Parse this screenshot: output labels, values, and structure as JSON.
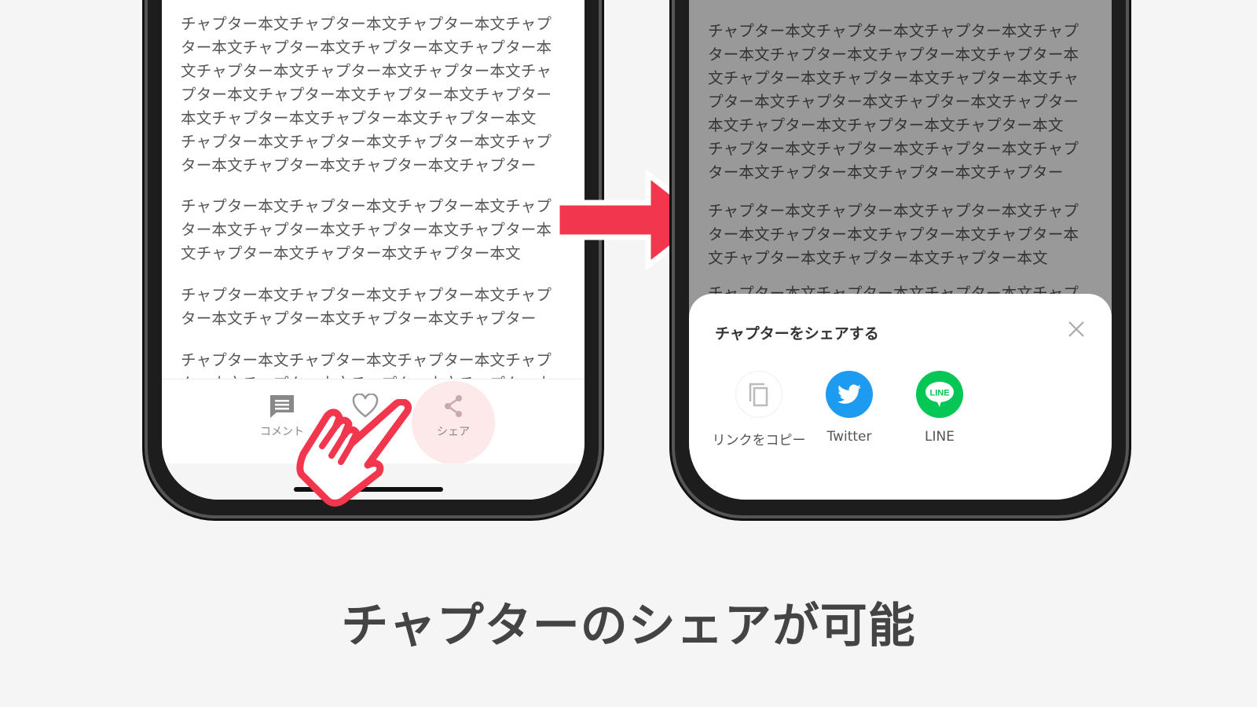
{
  "left_phone": {
    "paragraphs": [
      [
        "チャプター本文チャプター本文チャプター本文チャプ",
        "ター本文チャプター本文チャプター本文チャプター本",
        "文チャプター本文チャプター本文チャプター本文チャ",
        "プター本文チャプター本文チャプター本文チャプター",
        "本文チャプター本文チャプター本文チャプター本文",
        "チャプター本文チャプター本文チャプター本文チャプ",
        "ター本文チャプター本文チャプター本文チャプター"
      ],
      [
        "チャプター本文チャプター本文チャプター本文チャプ",
        "ター本文チャプター本文チャプター本文チャプター本",
        "文チャプター本文チャプター本文チャプター本文"
      ],
      [
        "チャプター本文チャプター本文チャプター本文チャプ",
        "ター本文チャプター本文チャプター本文チャプター"
      ],
      [
        "チャプター本文チャプター本文チャプター本文チャプ",
        "ター本文チャプター本文チャプター本文チャプター本"
      ]
    ],
    "tabs": {
      "comment": "コメント",
      "like": "",
      "share": "シェア"
    }
  },
  "right_phone": {
    "paragraphs": [
      [
        "チャプター本文チャプター本文チャプター本文チャプ",
        "ター本文チャプター本文チャプター本文チャプター本",
        "文チャプター本文チャプター本文チャプター本文チャ",
        "プター本文チャプター本文チャプター本文チャプター",
        "本文チャプター本文チャプター本文チャプター本文",
        "チャプター本文チャプター本文チャプター本文チャプ",
        "ター本文チャプター本文チャプター本文チャプター"
      ],
      [
        "チャプター本文チャプター本文チャプター本文チャプ",
        "ター本文チャプター本文チャプター本文チャプター本",
        "文チャプター本文チャプター本文チャプター本文"
      ],
      [
        "チャプター本文チャプター本文チャプター本文チャプ"
      ]
    ],
    "share_sheet": {
      "title": "チャプターをシェアする",
      "options": [
        {
          "label": "リンクをコピー",
          "icon": "copy-icon"
        },
        {
          "label": "Twitter",
          "icon": "twitter-icon",
          "color": "#1d9bf0"
        },
        {
          "label": "LINE",
          "icon": "line-icon",
          "color": "#06c755"
        }
      ]
    }
  },
  "colors": {
    "accent": "#f2364d",
    "share_highlight": "#fde8ea"
  },
  "caption": "チャプターのシェアが可能"
}
